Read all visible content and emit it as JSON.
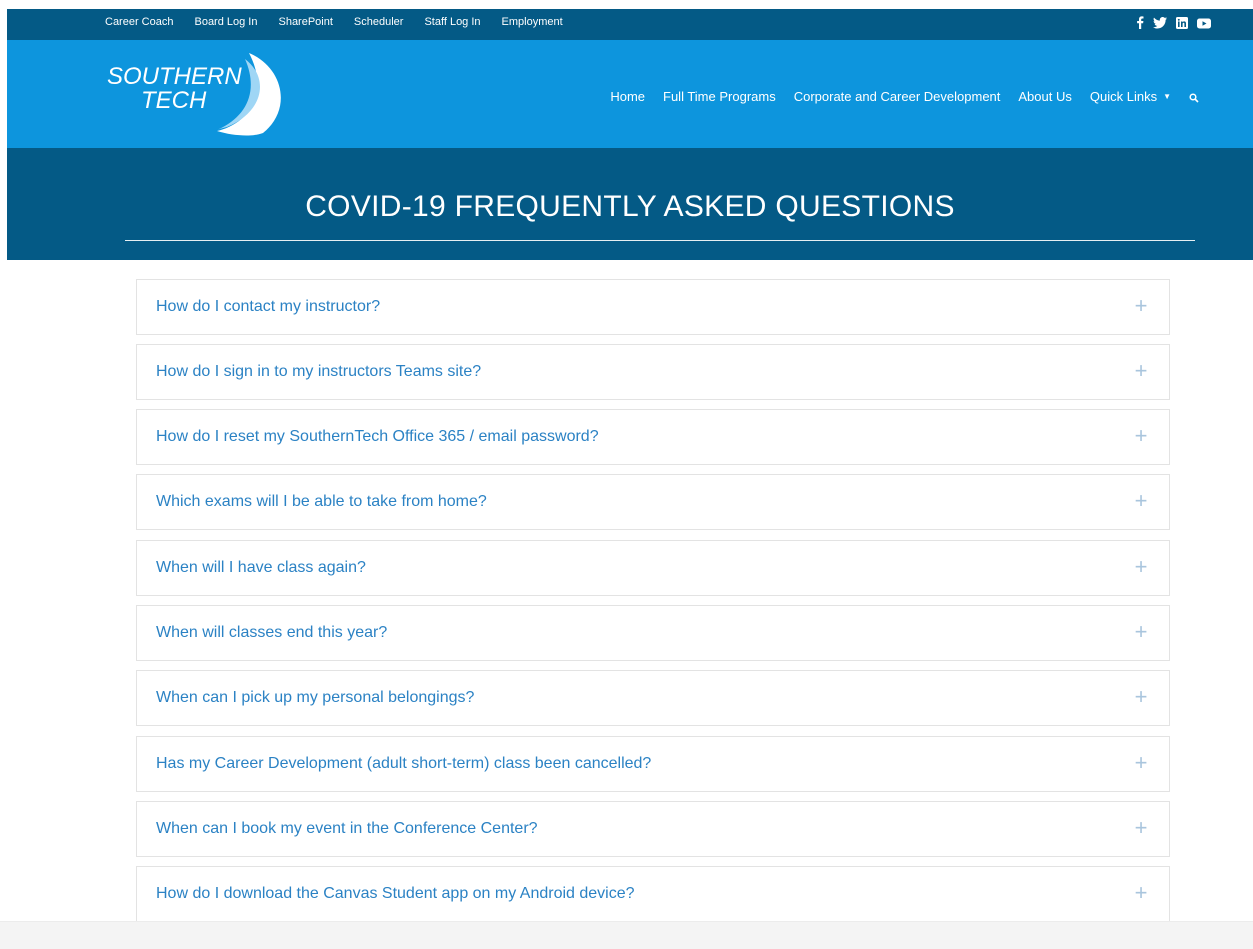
{
  "topbar": {
    "links": [
      "Career Coach",
      "Board Log In",
      "SharePoint",
      "Scheduler",
      "Staff Log In",
      "Employment"
    ],
    "social": [
      "facebook-icon",
      "twitter-icon",
      "linkedin-icon",
      "youtube-icon"
    ]
  },
  "header": {
    "logo_line1": "SOUTHERN",
    "logo_line2": "TECH",
    "nav": [
      "Home",
      "Full Time Programs",
      "Corporate and Career Development",
      "About Us",
      "Quick Links"
    ],
    "search_icon": "search-icon"
  },
  "page_title": "COVID-19 FREQUENTLY ASKED QUESTIONS",
  "faq": [
    "How do I contact my instructor?",
    "How do I sign in to my instructors Teams site?",
    "How do I reset my SouthernTech Office 365 / email password?",
    "Which exams will I be able to take from home?",
    "When will I have class again?",
    "When will classes end this year?",
    "When can I pick up my personal belongings?",
    "Has my Career Development (adult short-term) class been cancelled?",
    "When can I book my event in the Conference Center?",
    "How do I download the Canvas Student app on my Android device?"
  ],
  "expand_symbol": "+",
  "colors": {
    "dark_blue": "#045a86",
    "bright_blue": "#0d95dd",
    "link_blue": "#2b82c4",
    "plus_gray": "#a9c5dd"
  }
}
